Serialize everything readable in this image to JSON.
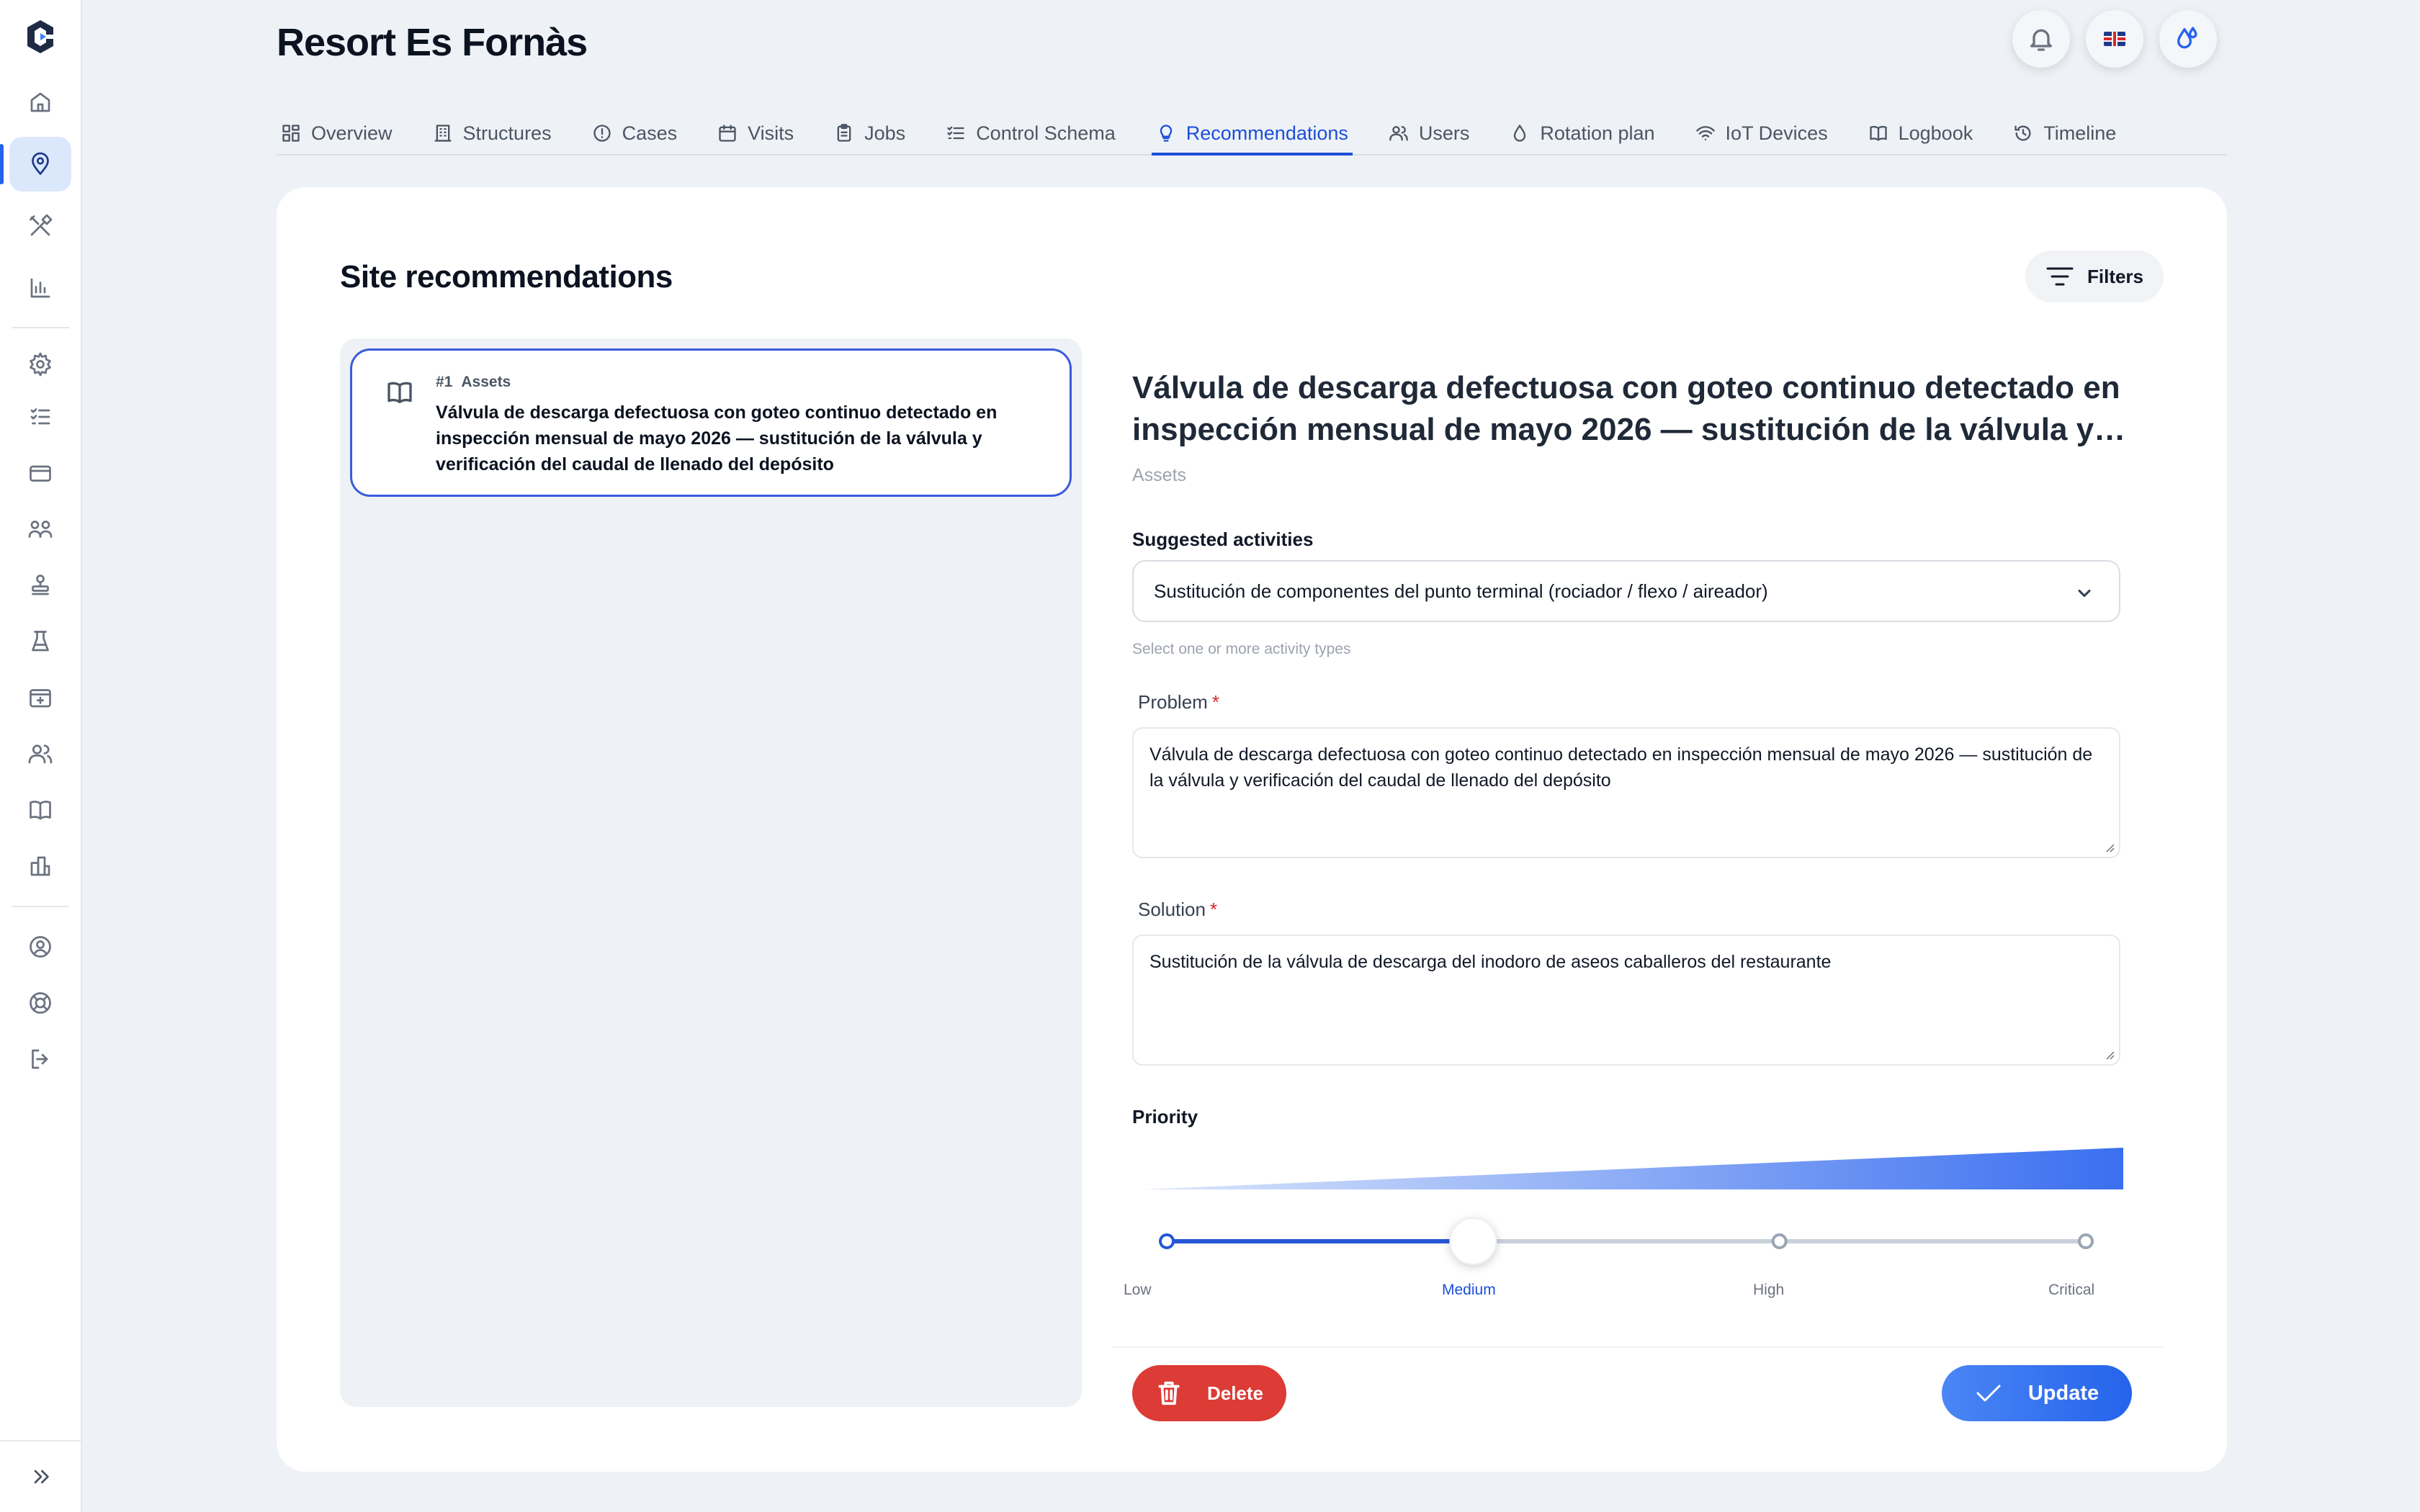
{
  "site": {
    "title": "Resort Es Fornàs"
  },
  "header": {
    "actions": [
      {
        "name": "notifications",
        "icon": "bell-icon"
      },
      {
        "name": "language",
        "icon": "uk-flag-icon"
      },
      {
        "name": "water",
        "icon": "water-drops-icon"
      }
    ]
  },
  "tabs": [
    {
      "label": "Overview",
      "icon": "grid-icon",
      "active": false
    },
    {
      "label": "Structures",
      "icon": "building-icon",
      "active": false
    },
    {
      "label": "Cases",
      "icon": "alert-circle-icon",
      "active": false
    },
    {
      "label": "Visits",
      "icon": "calendar-icon",
      "active": false
    },
    {
      "label": "Jobs",
      "icon": "clipboard-icon",
      "active": false
    },
    {
      "label": "Control Schema",
      "icon": "checklist-icon",
      "active": false
    },
    {
      "label": "Recommendations",
      "icon": "lightbulb-icon",
      "active": true
    },
    {
      "label": "Users",
      "icon": "users-icon",
      "active": false
    },
    {
      "label": "Rotation plan",
      "icon": "drop-icon",
      "active": false
    },
    {
      "label": "IoT Devices",
      "icon": "wifi-icon",
      "active": false
    },
    {
      "label": "Logbook",
      "icon": "book-icon",
      "active": false
    },
    {
      "label": "Timeline",
      "icon": "history-icon",
      "active": false
    }
  ],
  "main": {
    "title": "Site recommendations",
    "filters_label": "Filters",
    "list": [
      {
        "number": "#1",
        "category": "Assets",
        "text": "Válvula de descarga defectuosa con goteo continuo detectado en inspección mensual de mayo 2026 — sustitución de la válvula y verificación del caudal de llenado del depósito"
      }
    ],
    "detail": {
      "title": "Válvula de descarga defectuosa con goteo continuo detectado en inspección mensual de mayo 2026 — sustitución de la válvula y verificación del caudal de llenado del depósito",
      "category": "Assets",
      "activities_label": "Suggested activities",
      "activities_value": "Sustitución de componentes del punto terminal (rociador / flexo / aireador)",
      "activities_hint": "Select one or more activity types",
      "problem_label": "Problem",
      "problem_value": "Válvula de descarga defectuosa con goteo continuo detectado en inspección mensual de mayo 2026 — sustitución de la válvula y verificación del caudal de llenado del depósito",
      "solution_label": "Solution",
      "solution_value": "Sustitución de la válvula de descarga del inodoro de aseos caballeros del restaurante",
      "required_mark": "*",
      "priority_label": "Priority",
      "priority_levels": [
        "Low",
        "Medium",
        "High",
        "Critical"
      ],
      "priority_selected": "Medium",
      "priority_selected_index": 1,
      "delete_label": "Delete",
      "update_label": "Update"
    }
  },
  "colors": {
    "accent": "#1d4ed8",
    "danger": "#dc3b36",
    "selected_border": "#3b5bdb"
  }
}
